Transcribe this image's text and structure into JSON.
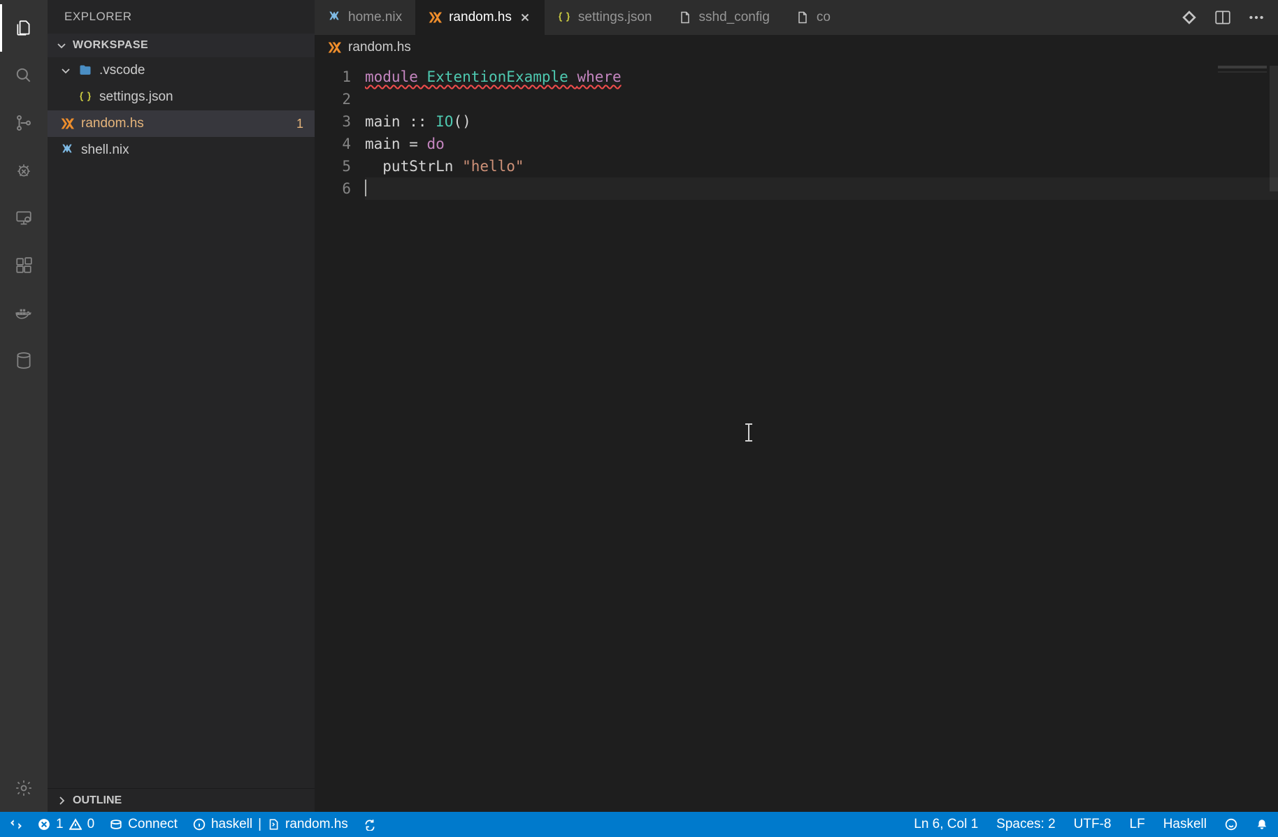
{
  "sidebar": {
    "title": "EXPLORER",
    "workspace": "WORKSPASE",
    "outline": "OUTLINE",
    "tree": [
      {
        "kind": "folder",
        "depth": 0,
        "expanded": true,
        "icon": "folder-vscode",
        "label": ".vscode"
      },
      {
        "kind": "file",
        "depth": 1,
        "icon": "json",
        "label": "settings.json"
      },
      {
        "kind": "file",
        "depth": 0,
        "active": true,
        "icon": "haskell",
        "label": "random.hs",
        "badge": "1"
      },
      {
        "kind": "file",
        "depth": 0,
        "icon": "nix",
        "label": "shell.nix"
      }
    ]
  },
  "tabs": [
    {
      "icon": "nix",
      "label": "home.nix",
      "active": false
    },
    {
      "icon": "haskell",
      "label": "random.hs",
      "active": true,
      "close": true
    },
    {
      "icon": "json",
      "label": "settings.json",
      "active": false
    },
    {
      "icon": "file",
      "label": "sshd_config",
      "active": false
    },
    {
      "icon": "file",
      "label": "co",
      "active": false,
      "truncated": true
    }
  ],
  "breadcrumb": {
    "icon": "haskell",
    "label": "random.hs"
  },
  "editor": {
    "lines": [
      [
        {
          "t": "module ",
          "c": "kw squig"
        },
        {
          "t": "ExtentionExample ",
          "c": "mod squig"
        },
        {
          "t": "where",
          "c": "kw squig"
        }
      ],
      [],
      [
        {
          "t": "main ",
          "c": "fn"
        },
        {
          "t": ":: ",
          "c": "op"
        },
        {
          "t": "IO",
          "c": "ty"
        },
        {
          "t": "()",
          "c": "op"
        }
      ],
      [
        {
          "t": "main ",
          "c": "fn"
        },
        {
          "t": "= ",
          "c": "op"
        },
        {
          "t": "do",
          "c": "kw"
        }
      ],
      [
        {
          "t": "  putStrLn ",
          "c": "fn"
        },
        {
          "t": "\"hello\"",
          "c": "str"
        }
      ],
      [
        {
          "t": "",
          "c": "",
          "cursor": true
        }
      ]
    ]
  },
  "status": {
    "remote_icon": true,
    "errors": "1",
    "warnings": "0",
    "connect": "Connect",
    "lsp": "haskell",
    "active_file": "random.hs",
    "cursor": "Ln 6, Col 1",
    "indent": "Spaces: 2",
    "encoding": "UTF-8",
    "eol": "LF",
    "language": "Haskell"
  }
}
